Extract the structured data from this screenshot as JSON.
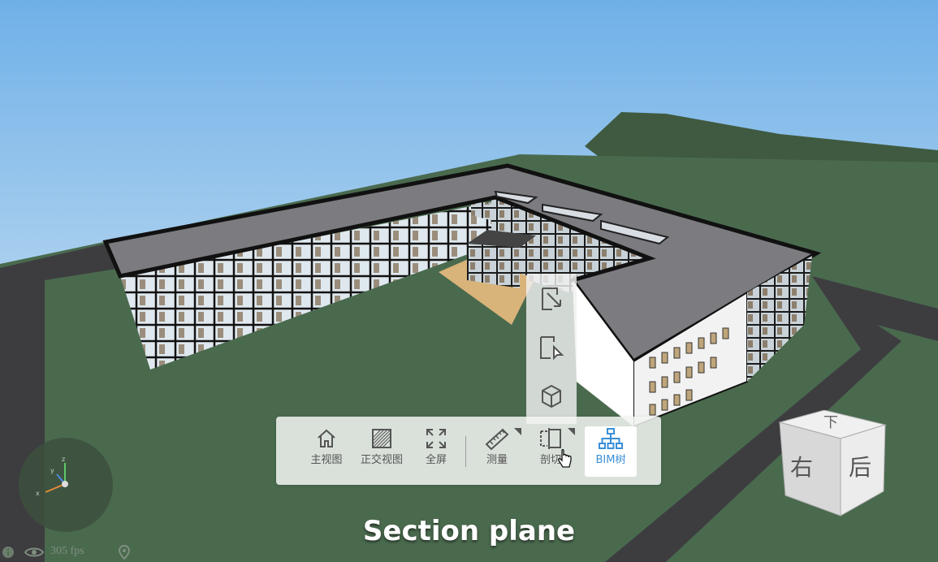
{
  "toolbar": {
    "items": [
      {
        "label": "主视图",
        "icon": "home-icon"
      },
      {
        "label": "正交视图",
        "icon": "orthographic-view-icon"
      },
      {
        "label": "全屏",
        "icon": "fullscreen-icon"
      },
      {
        "label": "测量",
        "icon": "ruler-icon"
      },
      {
        "label": "剖切",
        "icon": "section-icon"
      },
      {
        "label": "BIM树",
        "icon": "tree-icon"
      }
    ],
    "active_color": "#3a8fd8"
  },
  "section_popup": {
    "items": [
      {
        "icon": "section-axis-icon"
      },
      {
        "icon": "section-pick-face-icon"
      },
      {
        "icon": "section-box-icon"
      }
    ]
  },
  "viewcube": {
    "top_face": "下",
    "left_face": "右",
    "right_face": "后"
  },
  "axes": {
    "x": "x",
    "y": "y",
    "z": "z"
  },
  "status": {
    "fps": "305 fps"
  },
  "caption": "Section plane",
  "colors": {
    "sky_top": "#6fb0e8",
    "sky_bottom": "#a7cdeb",
    "grass": "#4a6a4e",
    "roof": "#7b7b80",
    "road": "#3d3d40"
  }
}
